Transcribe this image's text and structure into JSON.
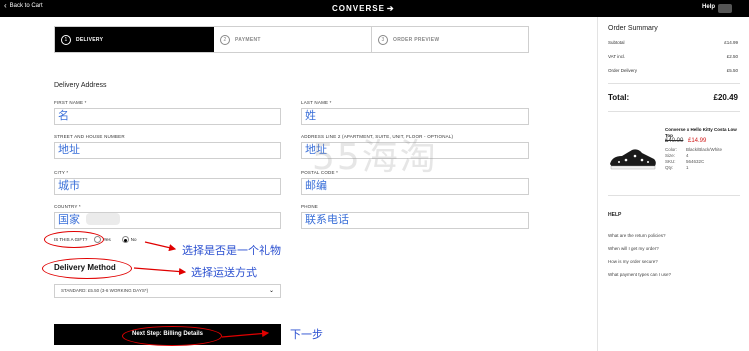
{
  "topbar": {
    "back_label": "Back to Cart",
    "logo": "CONVERSE",
    "help_label": "Help"
  },
  "steps": [
    {
      "num": "1",
      "label": "DELIVERY",
      "active": true
    },
    {
      "num": "2",
      "label": "PAYMENT",
      "active": false
    },
    {
      "num": "3",
      "label": "ORDER PREVIEW",
      "active": false
    }
  ],
  "form": {
    "section_title": "Delivery Address",
    "first_name": {
      "label": "FIRST NAME *",
      "value": "名"
    },
    "last_name": {
      "label": "LAST NAME *",
      "value": "姓"
    },
    "street": {
      "label": "STREET AND HOUSE NUMBER",
      "value": "地址"
    },
    "address2": {
      "label": "ADDRESS LINE 2 (APARTMENT, SUITE, UNIT, FLOOR - OPTIONAL)",
      "value": "地址"
    },
    "city": {
      "label": "CITY *",
      "value": "城市"
    },
    "postal": {
      "label": "POSTAL CODE *",
      "value": "邮编"
    },
    "country": {
      "label": "COUNTRY *",
      "value": "国家"
    },
    "phone": {
      "label": "PHONE",
      "value": "联系电话"
    },
    "gift": {
      "question": "IS THIS A GIFT?",
      "yes": "Yes",
      "no": "No",
      "selected": "No"
    },
    "delivery_method_title": "Delivery Method",
    "delivery_option": "STANDARD: £5.50 (3-6 WORKING DAYS*)",
    "next_button": "Next Step: Billing Details"
  },
  "annotations": {
    "gift_note": "选择是否是一个礼物",
    "shipping_note": "选择运送方式",
    "next_note": "下一步",
    "watermark": "55海淘"
  },
  "summary": {
    "title": "Order Summary",
    "subtotal_label": "Subtotal",
    "subtotal_value": "£14.99",
    "vat_label": "VAT incl.",
    "vat_value": "£2.50",
    "delivery_label": "Order Delivery",
    "delivery_value": "£5.50",
    "total_label": "Total:",
    "total_value": "£20.49"
  },
  "product": {
    "name": "Converse x Hello Kitty Costa Low Top",
    "price_old": "£40.00",
    "price_new": "£14.99",
    "attrs": [
      {
        "k": "Color:",
        "v": "Black/Black/White"
      },
      {
        "k": "Size:",
        "v": "4"
      },
      {
        "k": "SKU:",
        "v": "564632C"
      },
      {
        "k": "Qty:",
        "v": "1"
      }
    ]
  },
  "help": {
    "title": "HELP",
    "links": [
      "What are the return policies?",
      "When will I get my order?",
      "How is my order secure?",
      "What payment types can I use?"
    ]
  },
  "colors": {
    "annotation_blue": "#2a4fd0",
    "annotation_red": "#e00000",
    "sale_red": "#d01b1b"
  }
}
